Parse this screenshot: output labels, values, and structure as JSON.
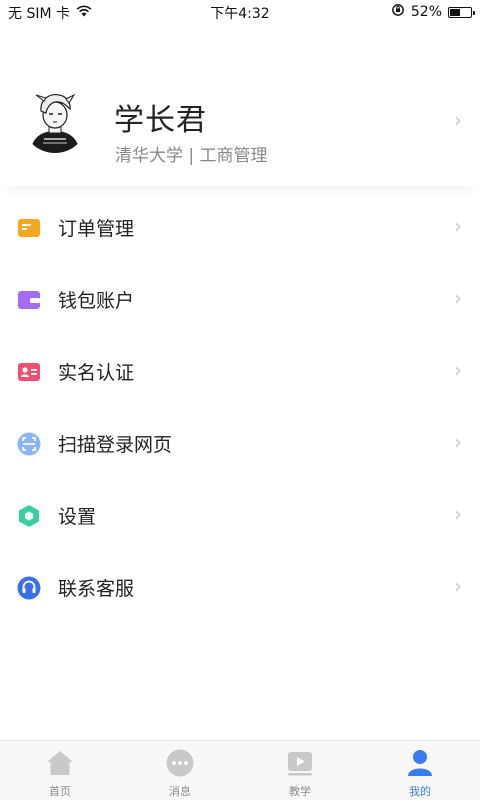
{
  "status_bar": {
    "carrier": "无 SIM 卡",
    "time": "下午4:32",
    "battery_percent": "52%",
    "battery_level": 0.52
  },
  "profile": {
    "name": "学长君",
    "subtitle": "清华大学 | 工商管理"
  },
  "menu": {
    "items": [
      {
        "label": "订单管理",
        "icon": "order-icon",
        "color": "#f5a623"
      },
      {
        "label": "钱包账户",
        "icon": "wallet-icon",
        "color": "#a66cf2"
      },
      {
        "label": "实名认证",
        "icon": "id-card-icon",
        "color": "#f0506e"
      },
      {
        "label": "扫描登录网页",
        "icon": "scan-icon",
        "color": "#5c9cf5"
      },
      {
        "label": "设置",
        "icon": "settings-icon",
        "color": "#3ccfa5"
      },
      {
        "label": "联系客服",
        "icon": "customer-service-icon",
        "color": "#3a6fe8"
      }
    ]
  },
  "tab_bar": {
    "tabs": [
      {
        "label": "首页",
        "icon": "home-icon",
        "active": false
      },
      {
        "label": "消息",
        "icon": "message-icon",
        "active": false
      },
      {
        "label": "教学",
        "icon": "play-icon",
        "active": false
      },
      {
        "label": "我的",
        "icon": "person-icon",
        "active": true
      }
    ]
  },
  "colors": {
    "accent": "#3a7bf0",
    "inactive_icon": "#c9c9c9"
  }
}
